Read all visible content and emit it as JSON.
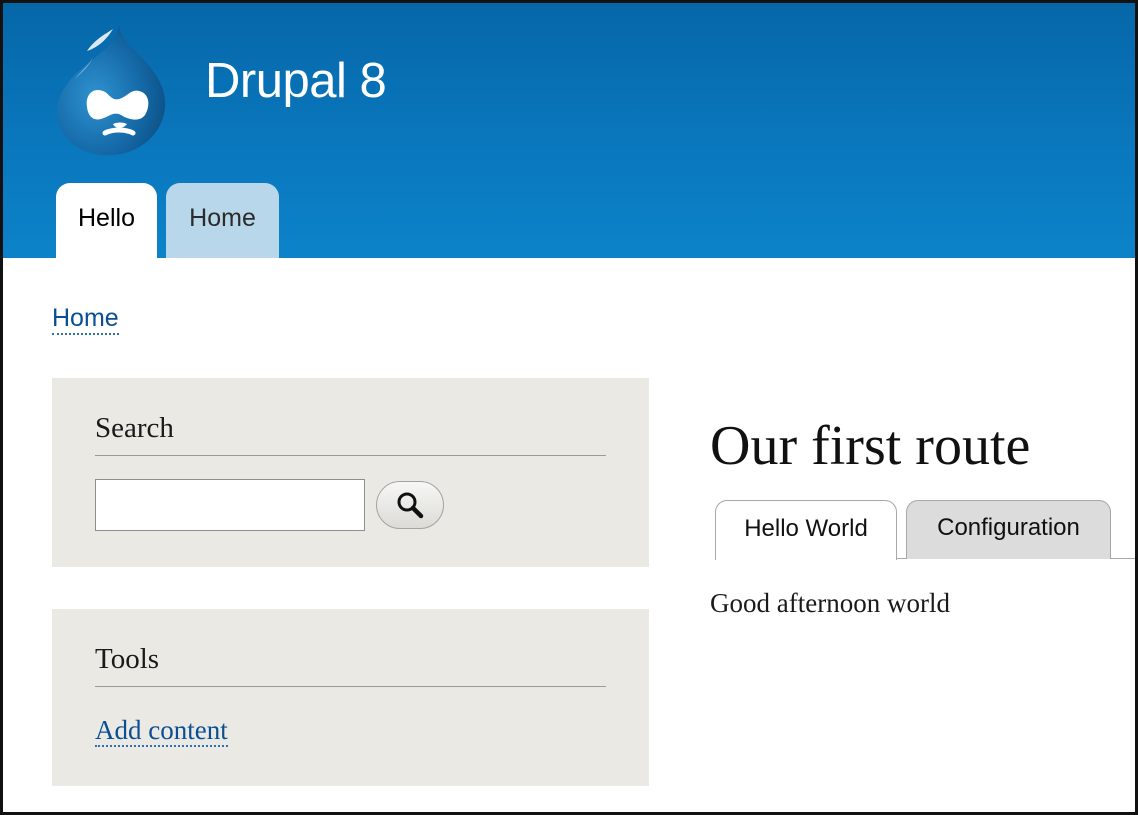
{
  "header": {
    "site_name": "Drupal 8",
    "logo_icon": "drupal-drop-icon",
    "tabs": [
      {
        "label": "Hello",
        "active": true
      },
      {
        "label": "Home",
        "active": false
      }
    ],
    "colors": {
      "header": "#0a77bd",
      "inactive_tab": "#b9d7ea"
    }
  },
  "breadcrumb": {
    "label": "Home"
  },
  "sidebar": {
    "search": {
      "title": "Search",
      "input_value": "",
      "button_icon": "magnifier-icon"
    },
    "tools": {
      "title": "Tools",
      "link_label": "Add content"
    },
    "colors": {
      "block_background": "#ebe9e3",
      "link": "#0a4f94"
    }
  },
  "main": {
    "title": "Our first route",
    "tabs": [
      {
        "label": "Hello World",
        "active": true
      },
      {
        "label": "Configuration",
        "active": false
      }
    ],
    "body": "Good afternoon world"
  }
}
